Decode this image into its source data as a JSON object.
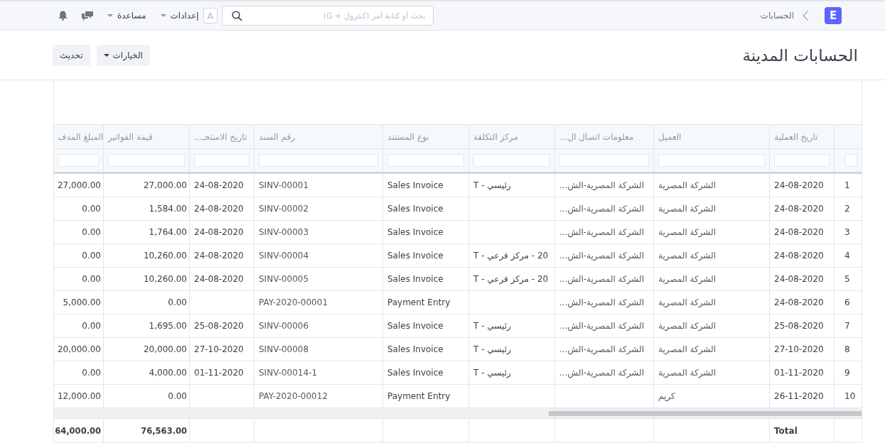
{
  "navbar": {
    "logo": "E",
    "breadcrumb": "الحسابات",
    "search": {
      "placeholder": "بحث أو كتابة أمر (كنترول + G)"
    },
    "avatar": "A",
    "menus": [
      {
        "label": "إعدادات"
      },
      {
        "label": "مساعدة"
      }
    ]
  },
  "page": {
    "title": "الحسابات المدينة",
    "buttons": [
      {
        "label": "الخيارات",
        "kind": "dropdown"
      },
      {
        "label": "تحديث",
        "kind": "plain"
      }
    ]
  },
  "table": {
    "columns": [
      {
        "label": "تاريخ العملية",
        "kind": "text"
      },
      {
        "label": "العميل",
        "kind": "text"
      },
      {
        "label": "معلومات اتصال ال...",
        "kind": "text"
      },
      {
        "label": "مركز التكلفة",
        "kind": "text"
      },
      {
        "label": "نوع المستند",
        "kind": "text"
      },
      {
        "label": "رقم السند",
        "kind": "text"
      },
      {
        "label": "تاريخ الاستحـ...",
        "kind": "text"
      },
      {
        "label": "قيمة الفواتير",
        "kind": "currency"
      },
      {
        "label": "المبلغ المدف",
        "kind": "currency"
      }
    ],
    "rows": [
      {
        "index": "1",
        "cells": [
          "24-08-2020",
          "الشركة المصرية",
          "الشركة المصرية-الش...",
          "رئيسي - T",
          "Sales Invoice",
          "SINV-00001",
          "24-08-2020",
          "27,000.00",
          "27,000.00"
        ]
      },
      {
        "index": "2",
        "cells": [
          "24-08-2020",
          "الشركة المصرية",
          "الشركة المصرية-الش...",
          null,
          "Sales Invoice",
          "SINV-00002",
          "24-08-2020",
          "1,584.00",
          "0.00"
        ]
      },
      {
        "index": "3",
        "cells": [
          "24-08-2020",
          "الشركة المصرية",
          "الشركة المصرية-الش...",
          null,
          "Sales Invoice",
          "SINV-00003",
          "24-08-2020",
          "1,764.00",
          "0.00"
        ]
      },
      {
        "index": "4",
        "cells": [
          "24-08-2020",
          "الشركة المصرية",
          "الشركة المصرية-الش...",
          "20 - مركز فرعي - T",
          "Sales Invoice",
          "SINV-00004",
          "24-08-2020",
          "10,260.00",
          "0.00"
        ]
      },
      {
        "index": "5",
        "cells": [
          "24-08-2020",
          "الشركة المصرية",
          "الشركة المصرية-الش...",
          "20 - مركز فرعي - T",
          "Sales Invoice",
          "SINV-00005",
          "24-08-2020",
          "10,260.00",
          "0.00"
        ]
      },
      {
        "index": "6",
        "cells": [
          "24-08-2020",
          "الشركة المصرية",
          "الشركة المصرية-الش...",
          null,
          "Payment Entry",
          "PAY-2020-00001",
          null,
          "0.00",
          "5,000.00"
        ]
      },
      {
        "index": "7",
        "cells": [
          "25-08-2020",
          "الشركة المصرية",
          "الشركة المصرية-الش...",
          "رئيسي - T",
          "Sales Invoice",
          "SINV-00006",
          "25-08-2020",
          "1,695.00",
          "0.00"
        ]
      },
      {
        "index": "8",
        "cells": [
          "27-10-2020",
          "الشركة المصرية",
          "الشركة المصرية-الش...",
          "رئيسي - T",
          "Sales Invoice",
          "SINV-00008",
          "27-10-2020",
          "20,000.00",
          "20,000.00"
        ]
      },
      {
        "index": "9",
        "cells": [
          "01-11-2020",
          "الشركة المصرية",
          "الشركة المصرية-الش...",
          "رئيسي - T",
          "Sales Invoice",
          "SINV-00014-1",
          "01-11-2020",
          "4,000.00",
          "0.00"
        ]
      },
      {
        "index": "10",
        "cells": [
          "26-11-2020",
          "كريم",
          null,
          null,
          "Payment Entry",
          "PAY-2020-00012",
          null,
          "0.00",
          "12,000.00"
        ]
      }
    ],
    "totals": {
      "label": "Total",
      "amounts": [
        "76,563.00",
        "64,000.00"
      ]
    }
  }
}
